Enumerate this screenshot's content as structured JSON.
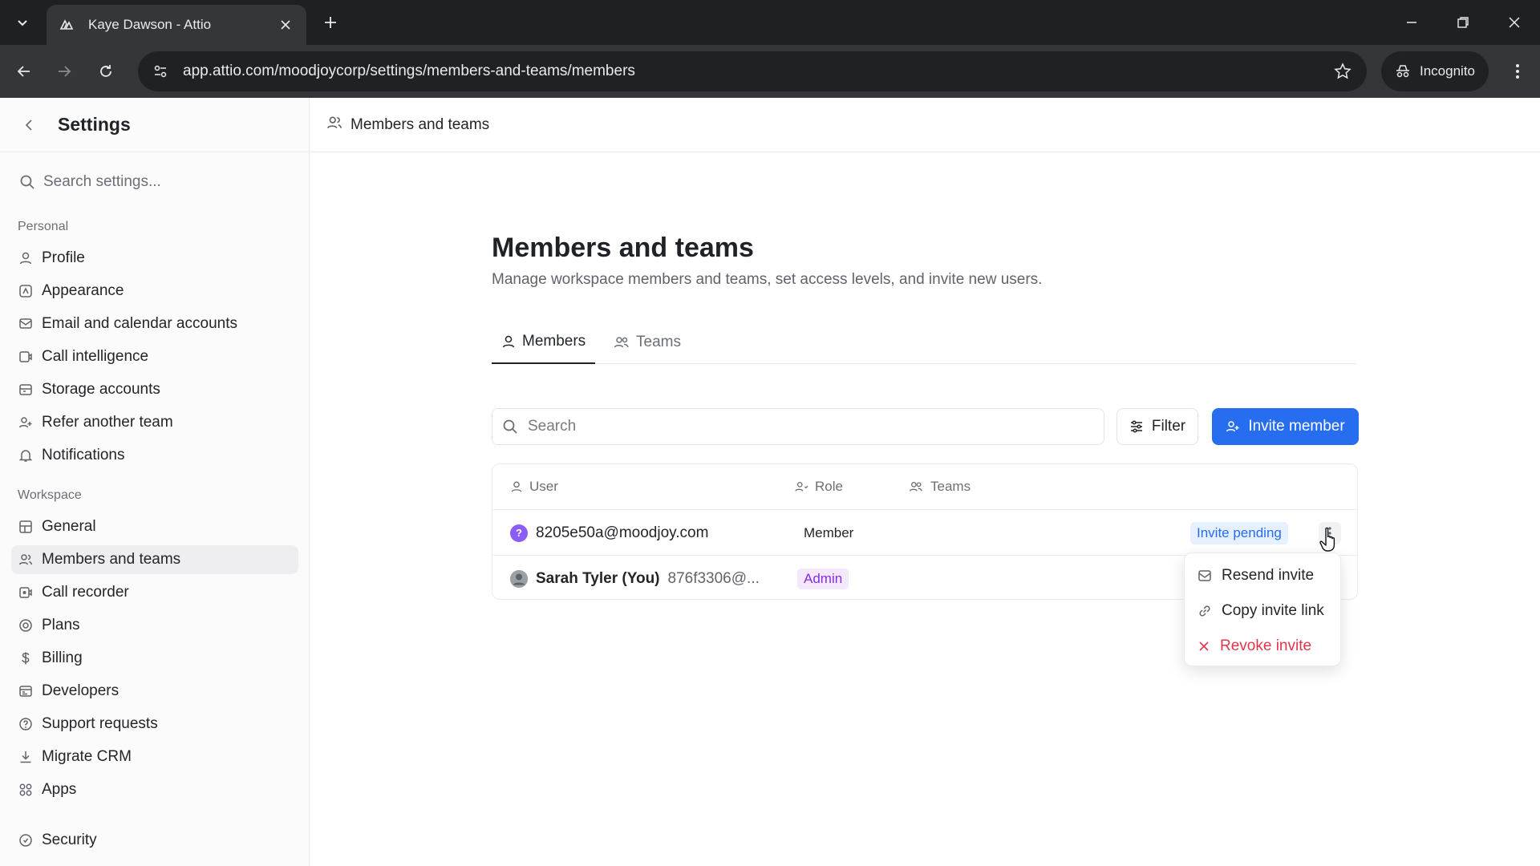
{
  "browser": {
    "tab_title": "Kaye Dawson - Attio",
    "url": "app.attio.com/moodjoycorp/settings/members-and-teams/members",
    "incognito_label": "Incognito"
  },
  "sidebar": {
    "title": "Settings",
    "search_placeholder": "Search settings...",
    "personal_label": "Personal",
    "personal_items": [
      {
        "label": "Profile",
        "icon": "user-icon"
      },
      {
        "label": "Appearance",
        "icon": "appearance-icon"
      },
      {
        "label": "Email and calendar accounts",
        "icon": "mail-calendar-icon"
      },
      {
        "label": "Call intelligence",
        "icon": "call-intelligence-icon"
      },
      {
        "label": "Storage accounts",
        "icon": "storage-icon"
      },
      {
        "label": "Refer another team",
        "icon": "refer-icon"
      },
      {
        "label": "Notifications",
        "icon": "bell-icon"
      }
    ],
    "workspace_label": "Workspace",
    "workspace_items": [
      {
        "label": "General",
        "icon": "grid-icon"
      },
      {
        "label": "Members and teams",
        "icon": "users-icon",
        "active": true
      },
      {
        "label": "Call recorder",
        "icon": "call-recorder-icon"
      },
      {
        "label": "Plans",
        "icon": "plans-icon"
      },
      {
        "label": "Billing",
        "icon": "dollar-icon"
      },
      {
        "label": "Developers",
        "icon": "developers-icon"
      },
      {
        "label": "Support requests",
        "icon": "help-icon"
      },
      {
        "label": "Migrate CRM",
        "icon": "download-icon"
      },
      {
        "label": "Apps",
        "icon": "apps-icon"
      }
    ],
    "security_label": "Security"
  },
  "main": {
    "header_title": "Members and teams",
    "page_title": "Members and teams",
    "page_subtitle": "Manage workspace members and teams, set access levels, and invite new users.",
    "tabs": [
      {
        "label": "Members",
        "active": true
      },
      {
        "label": "Teams",
        "active": false
      }
    ],
    "search_placeholder": "Search",
    "filter_label": "Filter",
    "invite_label": "Invite member",
    "columns": {
      "user": "User",
      "role": "Role",
      "teams": "Teams"
    },
    "rows": [
      {
        "name": "",
        "email": "8205e50a@moodjoy.com",
        "role": "Member",
        "status": "Invite pending",
        "avatar_color": "#8b5cf6",
        "avatar_glyph": "?"
      },
      {
        "name": "Sarah Tyler (You)",
        "email": "876f3306@...",
        "role": "Admin",
        "status": "",
        "avatar_color": "#9aa0a6",
        "avatar_glyph": ""
      }
    ],
    "dropdown": [
      {
        "label": "Resend invite",
        "icon": "mail-icon"
      },
      {
        "label": "Copy invite link",
        "icon": "link-icon"
      },
      {
        "label": "Revoke invite",
        "icon": "x-icon",
        "danger": true
      }
    ]
  },
  "colors": {
    "accent": "#266df0",
    "danger": "#e0364d",
    "admin_badge": "#8a2be2"
  }
}
